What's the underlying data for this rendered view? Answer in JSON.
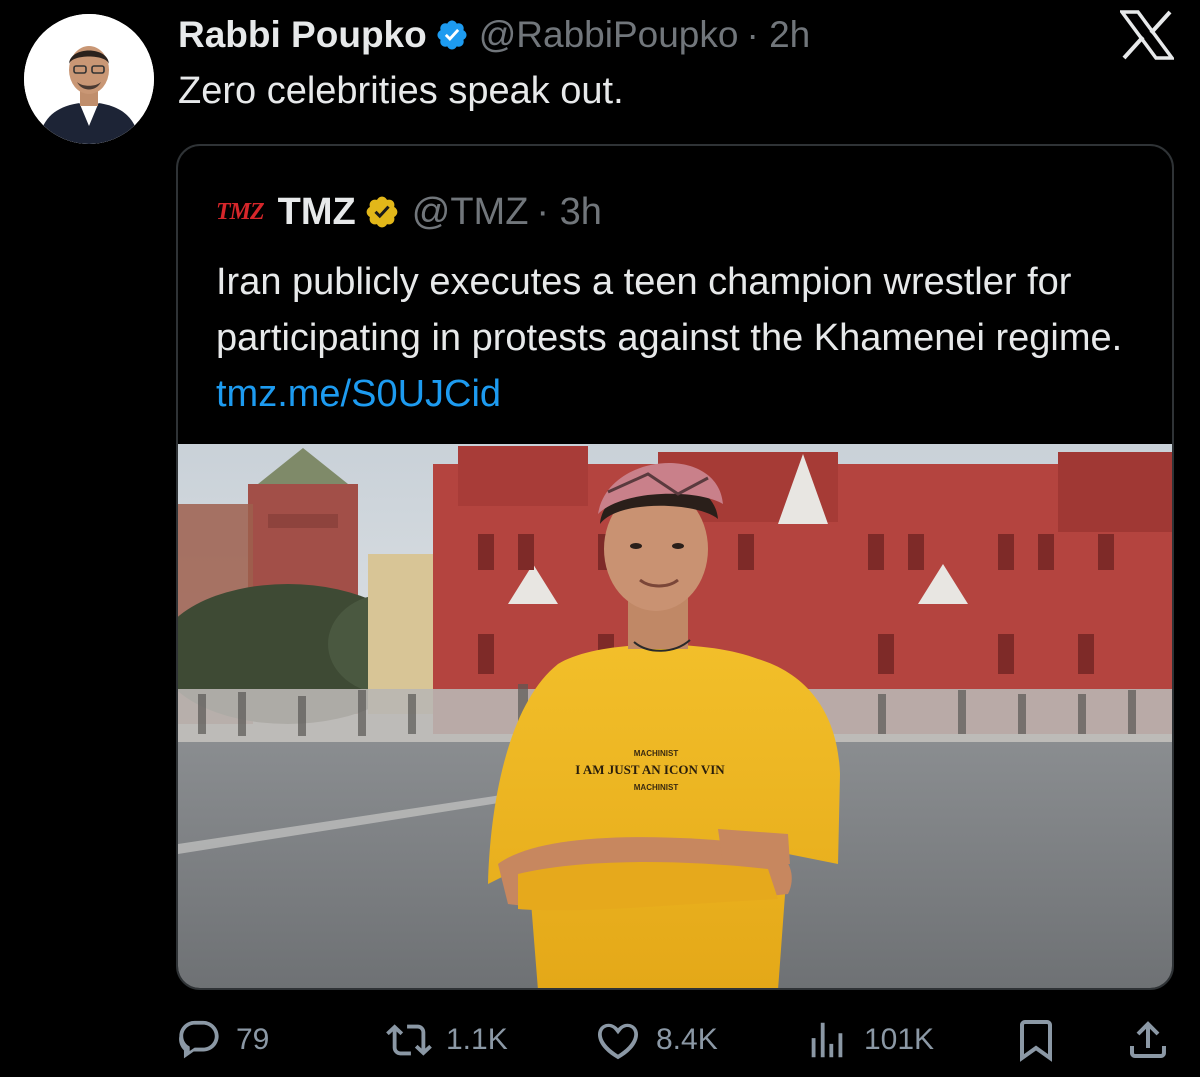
{
  "author": {
    "name": "Rabbi Poupko",
    "handle": "@RabbiPoupko",
    "time": "· 2h"
  },
  "tweet": {
    "text": "Zero celebrities speak out."
  },
  "quoted": {
    "logo_text": "TMZ",
    "name": "TMZ",
    "handle": "@TMZ",
    "time": "· 3h",
    "text": "Iran publicly executes a teen champion wrestler for participating in protests against the Khamenei regime. ",
    "link": "tmz.me/S0UJCid",
    "shirt_text": {
      "brand_top": "MACHINIST",
      "line": "I AM JUST AN ICON VIN",
      "brand_bottom": "MACHINIST"
    }
  },
  "actions": {
    "replies": "79",
    "reposts": "1.1K",
    "likes": "8.4K",
    "views": "101K"
  },
  "colors": {
    "background": "#000000",
    "text": "#e7e9ea",
    "muted": "#71767b",
    "link": "#1d9bf0",
    "verified_blue": "#1d9bf0",
    "verified_gold": "#e2b719",
    "tmz_red": "#d6262a"
  },
  "icons": {
    "close": "x-logo-icon",
    "verified": "verified-badge-icon",
    "reply": "reply-icon",
    "repost": "repost-icon",
    "like": "heart-icon",
    "views": "views-icon",
    "bookmark": "bookmark-icon",
    "share": "share-icon"
  }
}
